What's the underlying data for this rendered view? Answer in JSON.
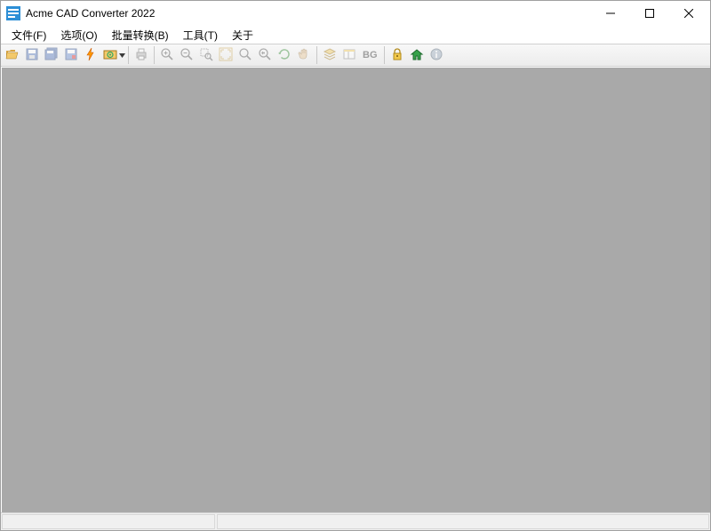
{
  "window": {
    "title": "Acme CAD Converter 2022"
  },
  "menu": {
    "file": "文件(F)",
    "options": "选项(O)",
    "batch": "批量转换(B)",
    "tools": "工具(T)",
    "about": "关于"
  },
  "toolbar": {
    "bg_label": "BG"
  },
  "status": {
    "left": "",
    "right": ""
  }
}
